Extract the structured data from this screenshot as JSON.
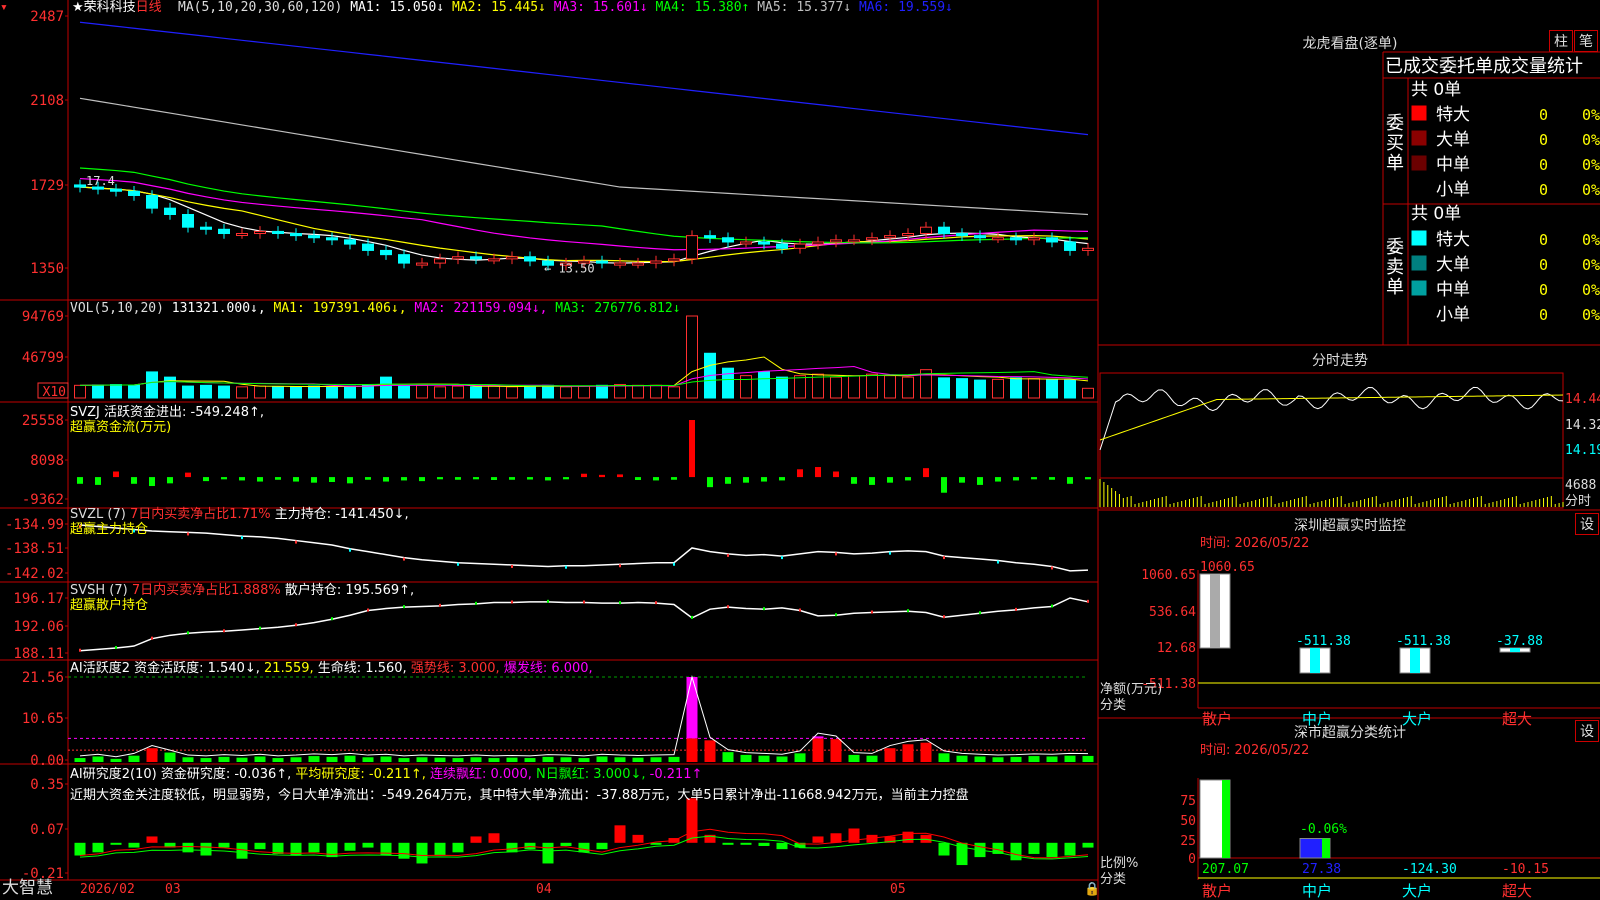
{
  "main": {
    "title_star": "★",
    "stock": "荣科科技",
    "period": "日线",
    "ma_header": "MA(5,10,20,30,60,120)",
    "ma": [
      {
        "label": "MA1: 15.050↓",
        "color": "#ffffff"
      },
      {
        "label": "MA2: 15.445↓",
        "color": "#ffff00"
      },
      {
        "label": "MA3: 15.601↓",
        "color": "#ff00ff"
      },
      {
        "label": "MA4: 15.380↑",
        "color": "#00ff00"
      },
      {
        "label": "MA5: 15.377↓",
        "color": "#c0c0c0"
      },
      {
        "label": "MA6: 19.559↓",
        "color": "#2020ff"
      }
    ],
    "y_ticks": [
      "2487",
      "2108",
      "1729",
      "1350"
    ],
    "low_marker": "← 13.50",
    "high_marker": "17.4"
  },
  "vol": {
    "header": "VOL(5,10,20)",
    "value": "131321.000↓,",
    "ma1": "MA1: 197391.406↓,",
    "ma2": "MA2: 221159.094↓,",
    "ma3": "MA3: 276776.812↓",
    "y_ticks": [
      "94769",
      "46799"
    ],
    "unit": "X10"
  },
  "svzj": {
    "header": "SVZJ  活跃资金进出: -549.248↑,",
    "sub": "超赢资金流(万元)",
    "y_ticks": [
      "25558",
      "8098",
      "-9362"
    ]
  },
  "svzl": {
    "header": "SVZL (7) ",
    "red": "7日内买卖净占比1.71%",
    "tail": " 主力持仓: -141.450↓,",
    "sub": "超赢主力持仓",
    "y_ticks": [
      "-134.99",
      "-138.51",
      "-142.02"
    ]
  },
  "svsh": {
    "header": "SVSH (7) ",
    "red": "7日内买卖净占比1.888%",
    "tail": " 散户持仓: 195.569↑,",
    "sub": "超赢散户持仓",
    "y_ticks": [
      "196.17",
      "192.06",
      "188.11"
    ]
  },
  "ai1": {
    "header": "AI活跃度2 资金活跃度: 1.540↓,",
    "v2": "21.559,",
    "v3": "生命线: 1.560,",
    "v4": "强势线: 3.000,",
    "v5": "爆发线: 6.000,",
    "y_ticks": [
      "21.56",
      "10.65",
      "0.00"
    ]
  },
  "ai2": {
    "header": "AI研究度2(10) 资金研究度: -0.036↑,",
    "v2": "平均研究度: -0.211↑,",
    "v3": "连续飘红: 0.000,",
    "v4": "N日飘红: 3.000↓,",
    "v5": "-0.211↑",
    "text": "近期大资金关注度较低，明显弱势，今日大单净流出：-549.264万元，其中特大单净流出：-37.88万元，大单5日累计净出-11668.942万元，当前主力控盘",
    "y_ticks": [
      "0.35",
      "0.07",
      "-0.21"
    ]
  },
  "xaxis": {
    "brand": "大智慧",
    "labels": [
      "2026/02",
      "03",
      "04",
      "05"
    ]
  },
  "dragon": {
    "title": "龙虎看盘(逐单)",
    "btn1": "柱",
    "btn2": "笔",
    "header": "已成交委托单成交量统计",
    "buy_label": "委买单",
    "sell_label": "委卖单",
    "buy_total": "共 0单",
    "sell_total": "共 0单",
    "rows_buy": [
      {
        "name": "特大",
        "v": "0",
        "p": "0%",
        "color": "#ff0000"
      },
      {
        "name": "大单",
        "v": "0",
        "p": "0%",
        "color": "#8b0000"
      },
      {
        "name": "中单",
        "v": "0",
        "p": "0%",
        "color": "#6b0000"
      },
      {
        "name": "小单",
        "v": "0",
        "p": "0%",
        "color": "#000000"
      }
    ],
    "rows_sell": [
      {
        "name": "特大",
        "v": "0",
        "p": "0%",
        "color": "#00ffff"
      },
      {
        "name": "大单",
        "v": "0",
        "p": "0%",
        "color": "#008080"
      },
      {
        "name": "中单",
        "v": "0",
        "p": "0%",
        "color": "#00a0a0"
      },
      {
        "name": "小单",
        "v": "0",
        "p": "0%",
        "color": "#000000"
      }
    ]
  },
  "intraday": {
    "title": "分时走势",
    "y_ticks": [
      "14.44",
      "14.32",
      "14.19"
    ],
    "vol_tick": "4688",
    "vol_label": "分时"
  },
  "sz_monitor": {
    "title": "深圳超赢实时监控",
    "btn": "设",
    "time": "时间: 2026/05/22",
    "y_ticks": [
      "1060.65",
      "536.64",
      "12.68",
      "-511.38"
    ],
    "unit1": "净额(万元)",
    "unit2": "分类",
    "bars": [
      {
        "cat": "散户",
        "value": 1060.65,
        "label": "1060.65"
      },
      {
        "cat": "中户",
        "value": -511.38,
        "label": "-511.38"
      },
      {
        "cat": "大户",
        "value": -511.38,
        "label": "-511.38"
      },
      {
        "cat": "超大",
        "value": -37.88,
        "label": "-37.88"
      }
    ]
  },
  "sz_class": {
    "title": "深市超赢分类统计",
    "btn": "设",
    "time": "时间: 2026/05/22",
    "y_ticks": [
      "75",
      "50",
      "25",
      "0"
    ],
    "unit1": "比例%",
    "unit2": "分类",
    "mid_label": "-0.06%",
    "bars": [
      {
        "cat": "散户",
        "pct": 100,
        "label": "207.07"
      },
      {
        "cat": "中户",
        "pct": 25,
        "label": "27.38"
      },
      {
        "cat": "大户",
        "pct": 0,
        "label": "-124.30"
      },
      {
        "cat": "超大",
        "pct": 0,
        "label": "-10.15"
      }
    ]
  },
  "chart_data": {
    "type": "candlestick",
    "title": "荣科科技 日线",
    "x_labels": [
      "2026/02",
      "03",
      "04",
      "05"
    ],
    "close": [
      17.2,
      17.1,
      17.0,
      16.8,
      16.2,
      15.9,
      15.3,
      15.2,
      15.0,
      15.0,
      15.1,
      15.0,
      14.9,
      14.8,
      14.7,
      14.5,
      14.2,
      14.0,
      13.6,
      13.6,
      13.8,
      13.9,
      13.8,
      13.8,
      13.9,
      13.7,
      13.5,
      13.6,
      13.7,
      13.6,
      13.6,
      13.6,
      13.7,
      13.8,
      14.9,
      14.8,
      14.6,
      14.6,
      14.5,
      14.3,
      14.5,
      14.6,
      14.7,
      14.7,
      14.8,
      14.9,
      15.0,
      15.3,
      15.0,
      14.9,
      14.8,
      14.8,
      14.7,
      14.8,
      14.6,
      14.2,
      14.3
    ],
    "volume": [
      17000,
      17500,
      18000,
      17000,
      35000,
      28000,
      16000,
      17000,
      16000,
      15000,
      16000,
      15000,
      15000,
      16000,
      15500,
      16000,
      17000,
      28000,
      16000,
      17000,
      15000,
      16000,
      15000,
      16000,
      15000,
      16000,
      17000,
      15000,
      16000,
      17000,
      18000,
      17000,
      17000,
      15000,
      110000,
      60000,
      40000,
      30000,
      35000,
      28000,
      30000,
      32000,
      28000,
      30000,
      32000,
      30000,
      28000,
      38000,
      27000,
      26000,
      24000,
      25000,
      27000,
      26000,
      25000,
      24000,
      13000
    ],
    "svzj": [
      -3000,
      -3500,
      2500,
      -3000,
      -4000,
      -2800,
      2000,
      -1800,
      -1000,
      -1500,
      -2000,
      -1200,
      -2000,
      -2500,
      -2200,
      -2800,
      -1200,
      -2000,
      -1500,
      -1800,
      -1000,
      -1200,
      -1000,
      -1300,
      -1200,
      -1100,
      -1500,
      -1000,
      1500,
      1000,
      1200,
      -1300,
      -1500,
      -1200,
      25558,
      -4500,
      -3000,
      -2500,
      -2000,
      -1500,
      3500,
      4500,
      2500,
      -3000,
      -3500,
      -2500,
      -1500,
      4000,
      -7000,
      -2500,
      -3500,
      -2000,
      -1500,
      -1000,
      -1200,
      -3000,
      -1000
    ],
    "svzl": [
      -135.4,
      -135.6,
      -135.8,
      -136.0,
      -136.2,
      -136.3,
      -136.4,
      -136.5,
      -136.7,
      -136.9,
      -137.0,
      -137.2,
      -137.5,
      -137.8,
      -138.1,
      -138.6,
      -139.0,
      -139.4,
      -139.8,
      -140.1,
      -140.3,
      -140.5,
      -140.6,
      -140.7,
      -140.8,
      -140.9,
      -141.0,
      -140.9,
      -140.9,
      -140.8,
      -140.7,
      -140.6,
      -140.5,
      -140.5,
      -138.5,
      -139.0,
      -139.3,
      -139.5,
      -139.4,
      -139.6,
      -139.3,
      -139.0,
      -139.1,
      -139.3,
      -139.2,
      -139.0,
      -138.9,
      -139.0,
      -139.6,
      -139.8,
      -140.0,
      -140.2,
      -140.5,
      -140.7,
      -141.0,
      -141.6,
      -141.5
    ],
    "svsh": [
      188.3,
      188.5,
      188.7,
      189.0,
      190.1,
      190.6,
      190.9,
      191.1,
      191.2,
      191.4,
      191.6,
      191.8,
      192.1,
      192.5,
      193.0,
      193.6,
      194.3,
      194.6,
      194.8,
      194.9,
      195.0,
      195.2,
      195.3,
      195.5,
      195.5,
      195.6,
      195.6,
      195.5,
      195.5,
      195.4,
      195.4,
      195.5,
      195.4,
      195.2,
      193.2,
      194.5,
      194.8,
      194.6,
      194.5,
      194.7,
      194.3,
      193.5,
      193.6,
      193.9,
      194.0,
      194.1,
      194.2,
      194.0,
      193.3,
      193.6,
      193.9,
      194.2,
      194.4,
      194.7,
      194.9,
      196.17,
      195.6
    ],
    "ai_activity": [
      1.0,
      1.4,
      0.8,
      1.6,
      3.5,
      2.4,
      1.2,
      1.0,
      1.3,
      1.1,
      1.4,
      1.0,
      1.2,
      1.5,
      1.3,
      1.6,
      1.2,
      1.4,
      1.0,
      1.2,
      1.1,
      1.0,
      1.2,
      1.0,
      1.1,
      1.0,
      1.3,
      1.2,
      1.0,
      1.4,
      1.2,
      1.1,
      1.2,
      1.3,
      21.56,
      5.5,
      2.5,
      1.8,
      1.6,
      1.4,
      2.2,
      6.5,
      5.8,
      1.8,
      1.6,
      3.5,
      4.5,
      4.9,
      2.2,
      1.6,
      1.4,
      1.2,
      1.3,
      1.5,
      1.4,
      1.6,
      1.54
    ],
    "ai_research": [
      -0.1,
      -0.08,
      -0.02,
      -0.05,
      0.02,
      -0.05,
      -0.08,
      -0.1,
      -0.05,
      -0.12,
      -0.06,
      -0.09,
      -0.1,
      -0.08,
      -0.11,
      -0.07,
      -0.05,
      -0.1,
      -0.12,
      -0.15,
      -0.1,
      -0.08,
      0.02,
      0.04,
      -0.08,
      -0.06,
      -0.15,
      -0.04,
      -0.08,
      -0.06,
      0.09,
      0.03,
      -0.03,
      0.01,
      0.26,
      0.03,
      -0.02,
      -0.02,
      -0.04,
      -0.06,
      -0.05,
      0.02,
      0.04,
      0.07,
      0.03,
      0.02,
      0.05,
      0.03,
      -0.1,
      -0.16,
      -0.11,
      -0.09,
      -0.13,
      -0.09,
      -0.11,
      -0.1,
      -0.05
    ]
  }
}
